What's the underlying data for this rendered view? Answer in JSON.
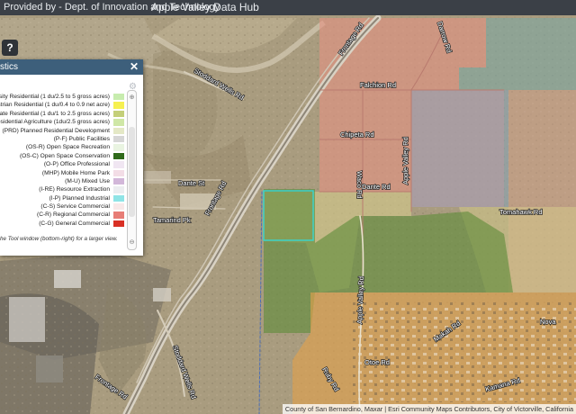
{
  "topbar": {
    "provider_text": "Provided by - Dept. of Innovation and Technology",
    "app_title": "Apple Valley Data Hub"
  },
  "help_button": {
    "label": "?"
  },
  "legend_panel": {
    "title": "stics",
    "close_label": "✕",
    "items": [
      {
        "label": "nsity Residential (1 du/2.5 to 5 gross acres)",
        "color": "#c7ecae"
      },
      {
        "label": "strian Residential (1 du/0.4 to 0.9 net acre)",
        "color": "#f6f051"
      },
      {
        "label": "state Residential (1 du/1 to 2.5 gross acres)",
        "color": "#c4cf79"
      },
      {
        "label": "esidential Agriculture (1du/2.5 gross acres)",
        "color": "#cfe7a6"
      },
      {
        "label": "(PRD) Planned Residential Development",
        "color": "#e4e8c6"
      },
      {
        "label": "(P-F) Public Facilities",
        "color": "#d6d6d6"
      },
      {
        "label": "(OS-R) Open Space Recreation",
        "color": "#e9f4e1"
      },
      {
        "label": "(OS-C) Open Space Conservation",
        "color": "#2f6a1a"
      },
      {
        "label": "(O-P) Office Professional",
        "color": "#f0e6f2"
      },
      {
        "label": "(MHP) Mobile Home Park",
        "color": "#f3dde6"
      },
      {
        "label": "(M-U) Mixed Use",
        "color": "#d2b7d9"
      },
      {
        "label": "(I-RE) Resource Extraction",
        "color": "#ecedf0"
      },
      {
        "label": "(I-P) Planned Industrial",
        "color": "#8fe4e6"
      },
      {
        "label": "(C-S) Service Commercial",
        "color": "#f8e9e9"
      },
      {
        "label": "(C-R) Regional Commercial",
        "color": "#e77d76"
      },
      {
        "label": "(C-G) General Commercial",
        "color": "#d93025"
      }
    ],
    "footnote": "he Tool window (bottom-right) for a larger view."
  },
  "map": {
    "zones": {
      "commercial_color": "#e39383",
      "tan_color": "#d6cc8a",
      "green_color": "#5f8c3a",
      "orange_color": "#e2a24c",
      "teal_color": "#7aa9a6",
      "blue_color": "#7ea7c7",
      "pink_color": "#e6a48f",
      "parcel_highlight_color": "#36d6d0"
    },
    "street_labels": {
      "frontage_rd_north": "Frontage Rd",
      "frontage_rd_mid": "Frontage Rd",
      "frontage_rd_south": "Frontage Rd",
      "stoddard_wells": "Stoddard Wells Rd",
      "stoddard_wells_south": "Stoddard Wells Rd",
      "falchion": "Falchion Rd",
      "chipeta": "Chipeta Rd",
      "dante_east": "Dante Rd",
      "dante_west": "Dante St",
      "apple_valley": "Apple Valley Rd",
      "apple_valley_south": "Apple Valley Rd",
      "waco": "Waco Rd",
      "darrow": "Darrow Rd",
      "tomahawk": "Tomahawk Rd",
      "tamarind": "Tamarind Pk",
      "otoe": "Otoe Rd",
      "ruby": "Ruby Rd",
      "makah": "Makah Rd",
      "kamana": "Kamana Rd",
      "nova": "Nova"
    }
  },
  "attribution": "County of San Bernardino, Maxar | Esri Community Maps Contributors, City of Victorville, California"
}
